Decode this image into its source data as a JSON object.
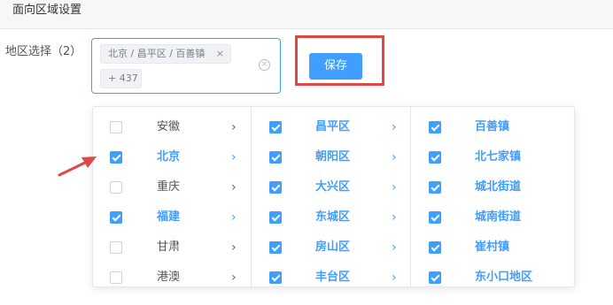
{
  "header": {
    "title": "面向区域设置"
  },
  "field": {
    "label": "地区选择（2）"
  },
  "input": {
    "tags": [
      {
        "text": "北京 / 昌平区 / 百善镇",
        "close": "×"
      },
      {
        "text": "+ 437"
      }
    ],
    "clear_icon": "×"
  },
  "toolbar": {
    "save_label": "保存"
  },
  "cascader": {
    "provinces": [
      {
        "label": "安徽",
        "checked": false
      },
      {
        "label": "北京",
        "checked": true
      },
      {
        "label": "重庆",
        "checked": false
      },
      {
        "label": "福建",
        "checked": true
      },
      {
        "label": "甘肃",
        "checked": false
      },
      {
        "label": "港澳",
        "checked": false
      }
    ],
    "districts": [
      {
        "label": "昌平区",
        "checked": true
      },
      {
        "label": "朝阳区",
        "checked": true
      },
      {
        "label": "大兴区",
        "checked": true
      },
      {
        "label": "东城区",
        "checked": true
      },
      {
        "label": "房山区",
        "checked": true
      },
      {
        "label": "丰台区",
        "checked": true
      }
    ],
    "towns": [
      {
        "label": "百善镇",
        "checked": true
      },
      {
        "label": "北七家镇",
        "checked": true
      },
      {
        "label": "城北街道",
        "checked": true
      },
      {
        "label": "城南街道",
        "checked": true
      },
      {
        "label": "崔村镇",
        "checked": true
      },
      {
        "label": "东小口地区",
        "checked": true
      }
    ],
    "arrow_glyph": "›"
  },
  "colors": {
    "accent": "#409eff",
    "highlight": "#e04848"
  },
  "icons": {
    "clear": "circle-close-icon",
    "expand": "chevron-right-icon",
    "tag_close": "close-icon"
  }
}
